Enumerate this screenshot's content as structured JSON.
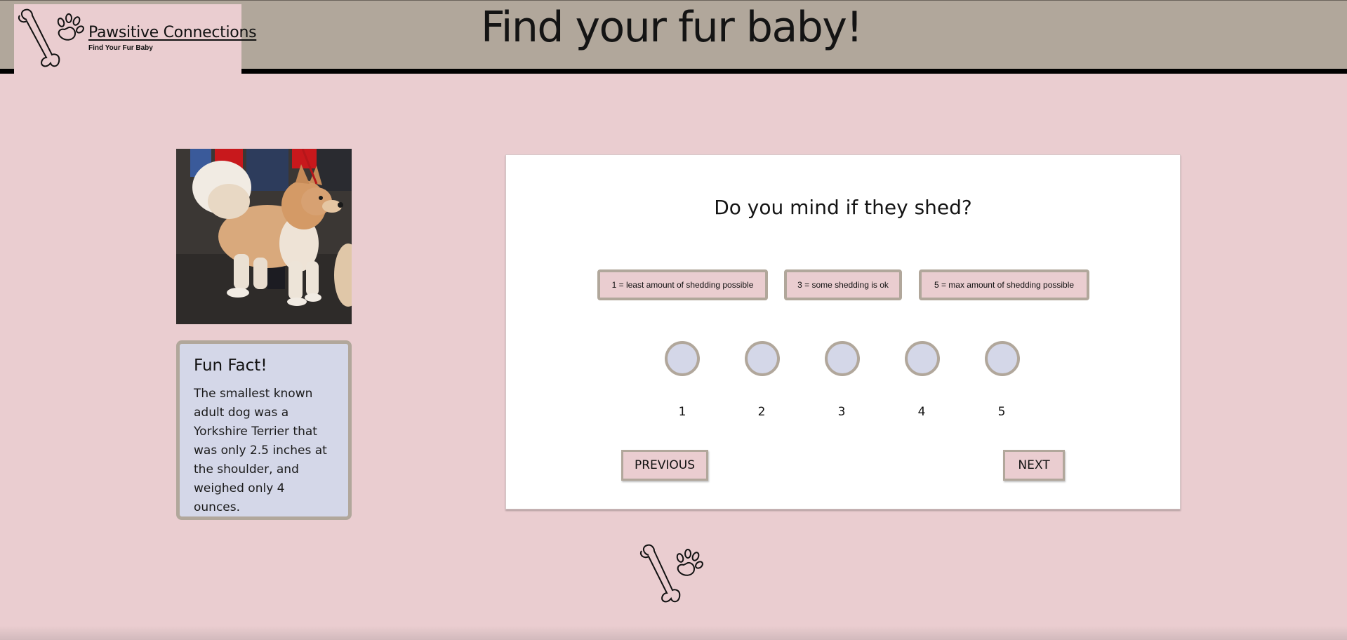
{
  "brand": {
    "name": "Pawsitive Connections",
    "tagline": "Find Your Fur Baby"
  },
  "header": {
    "title": "Find your fur baby!"
  },
  "sidebar": {
    "photo_subject": "dog-photo",
    "fact_title": "Fun Fact!",
    "fact_text": "The smallest known adult dog was a Yorkshire Terrier that was only 2.5 inches at the shoulder, and weighed only 4 ounces."
  },
  "quiz": {
    "question": "Do you mind if they shed?",
    "legend": [
      "1 = least amount of shedding possible",
      "3 = some shedding is ok",
      "5 = max amount of shedding possible"
    ],
    "options": [
      "1",
      "2",
      "3",
      "4",
      "5"
    ],
    "previous_label": "PREVIOUS",
    "next_label": "NEXT"
  },
  "colors": {
    "background": "#eacdd0",
    "header": "#b1a79b",
    "card": "#ffffff",
    "accent_blue": "#d4d7e8",
    "border_taupe": "#b1a79b"
  }
}
